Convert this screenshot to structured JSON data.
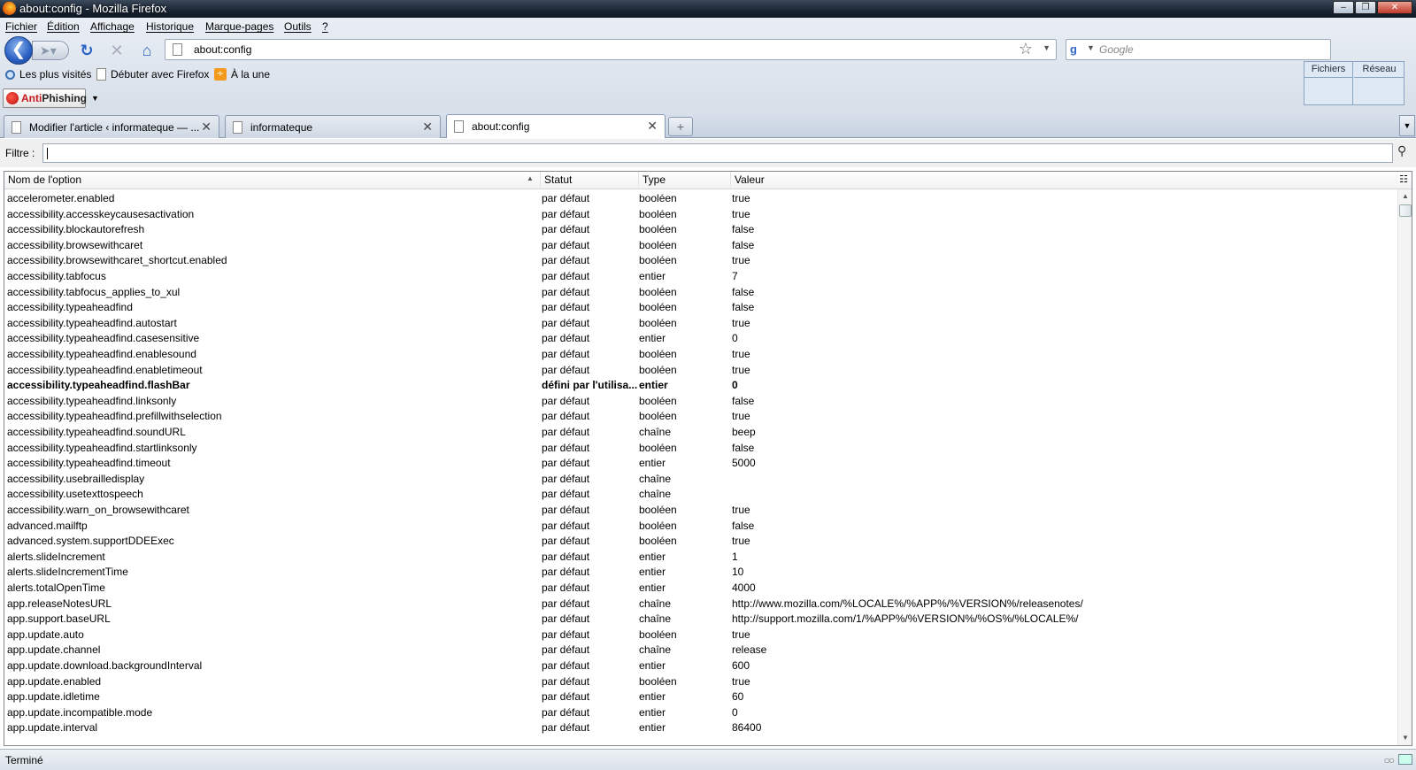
{
  "window": {
    "title": "about:config - Mozilla Firefox"
  },
  "menu": [
    "Fichier",
    "Édition",
    "Affichage",
    "Historique",
    "Marque-pages",
    "Outils",
    "?"
  ],
  "nav": {
    "url": "about:config",
    "search_placeholder": "Google"
  },
  "bookmarks": [
    {
      "label": "Les plus visités",
      "icon": "magnifier-icon"
    },
    {
      "label": "Débuter avec Firefox",
      "icon": "page-icon"
    },
    {
      "label": "À la une",
      "icon": "rss-icon"
    }
  ],
  "toolbar": {
    "antiphishing_anti": "Anti",
    "antiphishing_phish": "Phishing"
  },
  "float_panel": {
    "btn1": "Fichiers",
    "btn2": "Réseau"
  },
  "tabs": [
    {
      "label": "Modifier l'article ‹ informateque — ...",
      "active": false
    },
    {
      "label": "informateque",
      "active": false
    },
    {
      "label": "about:config",
      "active": true
    }
  ],
  "filter": {
    "label": "Filtre :"
  },
  "table": {
    "headers": {
      "name": "Nom de l'option",
      "status": "Statut",
      "type": "Type",
      "value": "Valeur"
    },
    "rows": [
      [
        "accelerometer.enabled",
        "par défaut",
        "booléen",
        "true"
      ],
      [
        "accessibility.accesskeycausesactivation",
        "par défaut",
        "booléen",
        "true"
      ],
      [
        "accessibility.blockautorefresh",
        "par défaut",
        "booléen",
        "false"
      ],
      [
        "accessibility.browsewithcaret",
        "par défaut",
        "booléen",
        "false"
      ],
      [
        "accessibility.browsewithcaret_shortcut.enabled",
        "par défaut",
        "booléen",
        "true"
      ],
      [
        "accessibility.tabfocus",
        "par défaut",
        "entier",
        "7"
      ],
      [
        "accessibility.tabfocus_applies_to_xul",
        "par défaut",
        "booléen",
        "false"
      ],
      [
        "accessibility.typeaheadfind",
        "par défaut",
        "booléen",
        "false"
      ],
      [
        "accessibility.typeaheadfind.autostart",
        "par défaut",
        "booléen",
        "true"
      ],
      [
        "accessibility.typeaheadfind.casesensitive",
        "par défaut",
        "entier",
        "0"
      ],
      [
        "accessibility.typeaheadfind.enablesound",
        "par défaut",
        "booléen",
        "true"
      ],
      [
        "accessibility.typeaheadfind.enabletimeout",
        "par défaut",
        "booléen",
        "true"
      ],
      [
        "accessibility.typeaheadfind.flashBar",
        "défini par l'utilisa...",
        "entier",
        "0"
      ],
      [
        "accessibility.typeaheadfind.linksonly",
        "par défaut",
        "booléen",
        "false"
      ],
      [
        "accessibility.typeaheadfind.prefillwithselection",
        "par défaut",
        "booléen",
        "true"
      ],
      [
        "accessibility.typeaheadfind.soundURL",
        "par défaut",
        "chaîne",
        "beep"
      ],
      [
        "accessibility.typeaheadfind.startlinksonly",
        "par défaut",
        "booléen",
        "false"
      ],
      [
        "accessibility.typeaheadfind.timeout",
        "par défaut",
        "entier",
        "5000"
      ],
      [
        "accessibility.usebrailledisplay",
        "par défaut",
        "chaîne",
        ""
      ],
      [
        "accessibility.usetexttospeech",
        "par défaut",
        "chaîne",
        ""
      ],
      [
        "accessibility.warn_on_browsewithcaret",
        "par défaut",
        "booléen",
        "true"
      ],
      [
        "advanced.mailftp",
        "par défaut",
        "booléen",
        "false"
      ],
      [
        "advanced.system.supportDDEExec",
        "par défaut",
        "booléen",
        "true"
      ],
      [
        "alerts.slideIncrement",
        "par défaut",
        "entier",
        "1"
      ],
      [
        "alerts.slideIncrementTime",
        "par défaut",
        "entier",
        "10"
      ],
      [
        "alerts.totalOpenTime",
        "par défaut",
        "entier",
        "4000"
      ],
      [
        "app.releaseNotesURL",
        "par défaut",
        "chaîne",
        "http://www.mozilla.com/%LOCALE%/%APP%/%VERSION%/releasenotes/"
      ],
      [
        "app.support.baseURL",
        "par défaut",
        "chaîne",
        "http://support.mozilla.com/1/%APP%/%VERSION%/%OS%/%LOCALE%/"
      ],
      [
        "app.update.auto",
        "par défaut",
        "booléen",
        "true"
      ],
      [
        "app.update.channel",
        "par défaut",
        "chaîne",
        "release"
      ],
      [
        "app.update.download.backgroundInterval",
        "par défaut",
        "entier",
        "600"
      ],
      [
        "app.update.enabled",
        "par défaut",
        "booléen",
        "true"
      ],
      [
        "app.update.idletime",
        "par défaut",
        "entier",
        "60"
      ],
      [
        "app.update.incompatible.mode",
        "par défaut",
        "entier",
        "0"
      ],
      [
        "app.update.interval",
        "par défaut",
        "entier",
        "86400"
      ]
    ],
    "bold_row": 12
  },
  "status": {
    "text": "Terminé"
  }
}
